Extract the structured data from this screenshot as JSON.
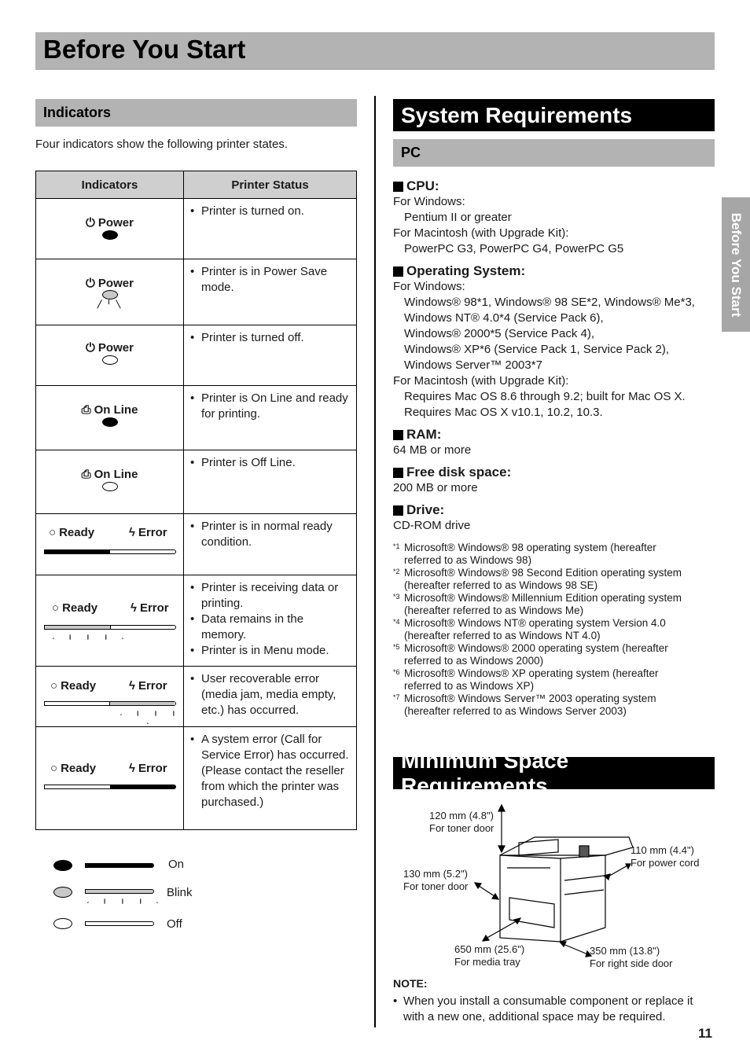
{
  "page_title": "Before You Start",
  "side_tab": "Before You Start",
  "page_number": "11",
  "indicators": {
    "heading": "Indicators",
    "intro": "Four indicators show the following printer states.",
    "table": {
      "headers": [
        "Indicators",
        "Printer Status"
      ],
      "rows": [
        {
          "indicator": "Power",
          "icon": "power-icon",
          "state": "on",
          "status": [
            "Printer is turned on."
          ]
        },
        {
          "indicator": "Power",
          "icon": "power-icon",
          "state": "blink",
          "status": [
            "Printer is in Power Save mode."
          ]
        },
        {
          "indicator": "Power",
          "icon": "power-icon",
          "state": "off",
          "status": [
            "Printer is turned off."
          ]
        },
        {
          "indicator": "On Line",
          "icon": "printer-icon",
          "state": "on",
          "status": [
            "Printer is On Line and ready for printing."
          ]
        },
        {
          "indicator": "On Line",
          "icon": "printer-icon",
          "state": "off",
          "status": [
            "Printer is Off Line."
          ]
        },
        {
          "indicator_left": "Ready",
          "indicator_right": "Error",
          "ready_state": "on",
          "error_state": "off",
          "status": [
            "Printer is in normal ready condition."
          ]
        },
        {
          "indicator_left": "Ready",
          "indicator_right": "Error",
          "ready_state": "blink",
          "error_state": "off",
          "status": [
            "Printer is receiving data or printing.",
            "Data remains in the memory.",
            "Printer is in Menu mode."
          ]
        },
        {
          "indicator_left": "Ready",
          "indicator_right": "Error",
          "ready_state": "off",
          "error_state": "blink",
          "status": [
            "User recoverable error (media jam, media empty, etc.) has occurred."
          ]
        },
        {
          "indicator_left": "Ready",
          "indicator_right": "Error",
          "ready_state": "off",
          "error_state": "on",
          "status": [
            "A system error (Call for Service Error) has occurred. (Please contact the reseller from which the printer was purchased.)"
          ]
        }
      ]
    },
    "legend": [
      {
        "state": "on",
        "label": "On"
      },
      {
        "state": "blink",
        "label": "Blink"
      },
      {
        "state": "off",
        "label": "Off"
      }
    ]
  },
  "system_requirements": {
    "heading": "System Requirements",
    "subheading": "PC",
    "cpu": {
      "label": "CPU:",
      "win_label": "For Windows:",
      "win_value": "Pentium II or greater",
      "mac_label": "For Macintosh (with Upgrade Kit):",
      "mac_value": "PowerPC G3, PowerPC G4, PowerPC G5"
    },
    "os": {
      "label": "Operating System:",
      "win_label": "For Windows:",
      "win_lines": [
        "Windows® 98*1, Windows® 98 SE*2, Windows® Me*3,",
        "Windows NT® 4.0*4 (Service Pack 6),",
        "Windows® 2000*5 (Service Pack 4),",
        "Windows® XP*6 (Service Pack 1, Service Pack 2),",
        "Windows Server™ 2003*7"
      ],
      "mac_label": "For Macintosh (with Upgrade Kit):",
      "mac_lines": [
        "Requires Mac OS 8.6 through 9.2; built for Mac OS X.",
        "Requires Mac OS X v10.1, 10.2, 10.3."
      ]
    },
    "ram": {
      "label": "RAM:",
      "value": "64 MB or more"
    },
    "disk": {
      "label": "Free disk space:",
      "value": "200 MB or more"
    },
    "drive": {
      "label": "Drive:",
      "value": "CD-ROM drive"
    },
    "footnotes": [
      {
        "mark": "*1",
        "line1": "Microsoft® Windows® 98 operating system (hereafter",
        "line2": "referred to as Windows 98)"
      },
      {
        "mark": "*2",
        "line1": "Microsoft® Windows® 98 Second Edition operating system",
        "line2": "(hereafter referred to as Windows 98 SE)"
      },
      {
        "mark": "*3",
        "line1": "Microsoft® Windows® Millennium Edition operating system",
        "line2": "(hereafter referred to as Windows Me)"
      },
      {
        "mark": "*4",
        "line1": "Microsoft® Windows NT® operating system Version 4.0",
        "line2": "(hereafter referred to as Windows NT 4.0)"
      },
      {
        "mark": "*5",
        "line1": "Microsoft® Windows® 2000 operating system (hereafter",
        "line2": "referred to as Windows 2000)"
      },
      {
        "mark": "*6",
        "line1": "Microsoft® Windows® XP operating system (hereafter",
        "line2": "referred to as Windows XP)"
      },
      {
        "mark": "*7",
        "line1": "Microsoft® Windows Server™ 2003 operating system",
        "line2": "(hereafter referred to as Windows Server 2003)"
      }
    ]
  },
  "space": {
    "heading": "Minimum Space Requirements",
    "callouts": [
      {
        "dim": "120 mm (4.8\")",
        "for": "For toner door"
      },
      {
        "dim": "110 mm (4.4\")",
        "for": "For power cord"
      },
      {
        "dim": "130 mm (5.2\")",
        "for": "For toner door"
      },
      {
        "dim": "650 mm (25.6\")",
        "for": "For media tray"
      },
      {
        "dim": "350 mm (13.8\")",
        "for": "For right side door"
      }
    ],
    "note_label": "NOTE:",
    "note_text": "When you install a consumable component or replace it with a new one, additional space may be required."
  }
}
